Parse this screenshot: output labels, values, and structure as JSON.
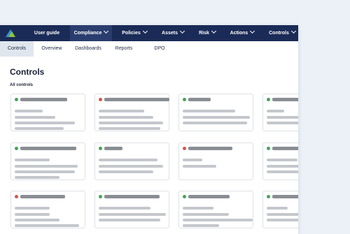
{
  "colors": {
    "nav_bg": "#1b2b57",
    "green_status": "#43a55a",
    "red_status": "#d9534f"
  },
  "logo_icon": "mountain-logo-icon",
  "nav": {
    "items": [
      {
        "label": "User guide",
        "dropdown": false,
        "active": false
      },
      {
        "label": "Compliance",
        "dropdown": true,
        "active": true
      },
      {
        "label": "Policies",
        "dropdown": true,
        "active": false
      },
      {
        "label": "Assets",
        "dropdown": true,
        "active": false
      },
      {
        "label": "Risk",
        "dropdown": true,
        "active": false
      },
      {
        "label": "Actions",
        "dropdown": true,
        "active": false
      },
      {
        "label": "Controls",
        "dropdown": true,
        "active": false
      }
    ]
  },
  "subnav": {
    "tabs": [
      {
        "label": "Controls",
        "active": true
      },
      {
        "label": "Overview",
        "active": false
      },
      {
        "label": "Dashboards",
        "active": false
      },
      {
        "label": "Reports",
        "active": false
      },
      {
        "label": "DPO",
        "active": false
      }
    ]
  },
  "page": {
    "title": "Controls",
    "section_label": "All controls"
  },
  "cards": [
    {
      "status": "green"
    },
    {
      "status": "red"
    },
    {
      "status": "green"
    },
    {
      "status": "green"
    },
    {
      "status": "green"
    },
    {
      "status": "green"
    },
    {
      "status": "red"
    },
    {
      "status": "green"
    },
    {
      "status": "red"
    },
    {
      "status": "green"
    },
    {
      "status": "green"
    },
    {
      "status": "green"
    }
  ]
}
